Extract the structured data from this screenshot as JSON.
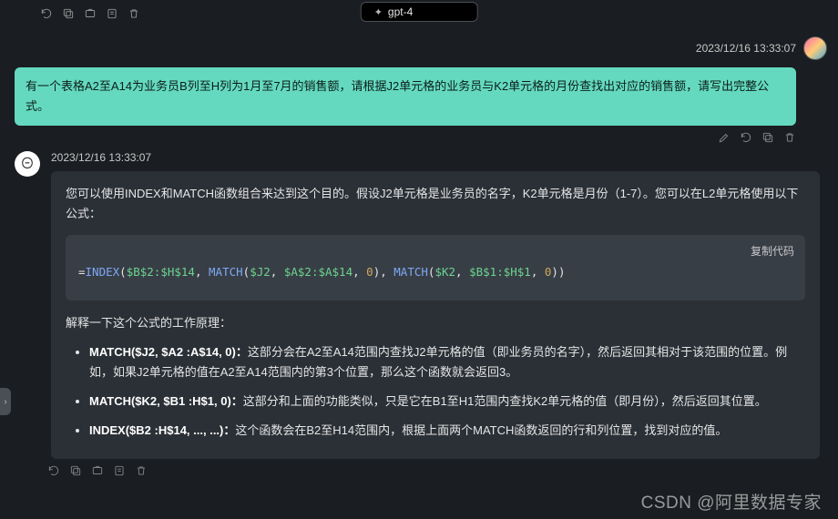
{
  "header": {
    "model": "gpt-4"
  },
  "user_message": {
    "timestamp": "2023/12/16 13:33:07",
    "text": "有一个表格A2至A14为业务员B列至H列为1月至7月的销售额，请根据J2单元格的业务员与K2单元格的月份查找出对应的销售额，请写出完整公式。"
  },
  "ai_message": {
    "timestamp": "2023/12/16 13:33:07",
    "intro": "您可以使用INDEX和MATCH函数组合来达到这个目的。假设J2单元格是业务员的名字，K2单元格是月份（1-7）。您可以在L2单元格使用以下公式：",
    "code_copy_label": "复制代码",
    "formula": {
      "prefix": "=",
      "fn1": "INDEX",
      "arg1_open": "(",
      "ref1": "$B$2:$H$14",
      "sep1": ", ",
      "fn2": "MATCH",
      "arg2_open": "(",
      "ref2": "$J2",
      "sep2": ", ",
      "ref3": "$A$2:$A$14",
      "sep3": ", ",
      "num1": "0",
      "arg2_close": "), ",
      "fn3": "MATCH",
      "arg3_open": "(",
      "ref4": "$K2",
      "sep4": ", ",
      "ref5": "$B$1:$H$1",
      "sep5": ", ",
      "num2": "0",
      "arg3_close": "))"
    },
    "explain_heading": "解释一下这个公式的工作原理：",
    "bullets": [
      {
        "bold": "MATCH($J2, $A2 :A$14, 0)：",
        "text": "这部分会在A2至A14范围内查找J2单元格的值（即业务员的名字），然后返回其相对于该范围的位置。例如，如果J2单元格的值在A2至A14范围内的第3个位置，那么这个函数就会返回3。"
      },
      {
        "bold": "MATCH($K2, $B1 :H$1, 0)：",
        "text": "这部分和上面的功能类似，只是它在B1至H1范围内查找K2单元格的值（即月份），然后返回其位置。"
      },
      {
        "bold": "INDEX($B2 :H$14, ..., ...)：",
        "text": "这个函数会在B2至H14范围内，根据上面两个MATCH函数返回的行和列位置，找到对应的值。"
      }
    ]
  },
  "watermark": "CSDN @阿里数据专家"
}
